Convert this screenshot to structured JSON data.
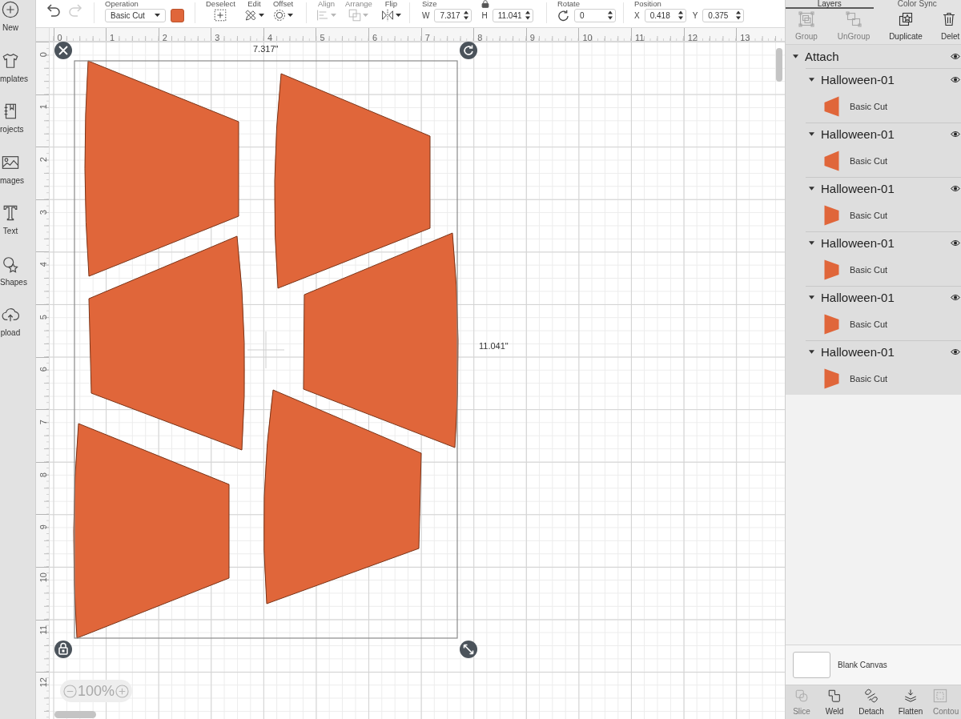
{
  "sidebar": {
    "items": [
      {
        "kind": "new",
        "label": "New"
      },
      {
        "kind": "templates",
        "label": "mplates"
      },
      {
        "kind": "projects",
        "label": "rojects"
      },
      {
        "kind": "images",
        "label": "mages"
      },
      {
        "kind": "text",
        "label": "Text"
      },
      {
        "kind": "shapes",
        "label": "Shapes"
      },
      {
        "kind": "upload",
        "label": "pload"
      }
    ]
  },
  "toolbar": {
    "undo": {
      "disabled": false
    },
    "redo": {
      "disabled": true
    },
    "operation": {
      "label": "Operation",
      "value": "Basic Cut",
      "color": "#e0663a"
    },
    "tool_groups": [
      [
        {
          "kind": "deselect",
          "label": "Deselect",
          "disabled": false,
          "menu": false
        },
        {
          "kind": "edit",
          "label": "Edit",
          "disabled": false,
          "menu": true
        },
        {
          "kind": "offset",
          "label": "Offset",
          "disabled": false,
          "menu": true
        }
      ],
      [
        {
          "kind": "align",
          "label": "Align",
          "disabled": true,
          "menu": true
        },
        {
          "kind": "arrange",
          "label": "Arrange",
          "disabled": true,
          "menu": true
        },
        {
          "kind": "flip",
          "label": "Flip",
          "disabled": false,
          "menu": true
        }
      ]
    ],
    "size": {
      "label": "Size",
      "width": {
        "label": "W",
        "value": "7.317"
      },
      "height": {
        "label": "H",
        "value": "11.041"
      },
      "locked": true
    },
    "rotate": {
      "label": "Rotate",
      "value": "0"
    },
    "position": {
      "label": "Position",
      "x": {
        "label": "X",
        "value": "0.418"
      },
      "y": {
        "label": "Y",
        "value": "0.375"
      }
    }
  },
  "rulers": {
    "horizontal": [
      "0",
      "1",
      "2",
      "3",
      "4",
      "5",
      "6",
      "7",
      "8",
      "9",
      "10",
      "11",
      "12",
      "13"
    ],
    "vertical": [
      "0",
      "1",
      "2",
      "3",
      "4",
      "5",
      "6",
      "7",
      "8",
      "9",
      "10",
      "11",
      "12"
    ]
  },
  "canvas": {
    "width_label": "7.317\"",
    "height_label": "11.041\"",
    "zoom": "100%"
  },
  "layers_panel": {
    "tabs": [
      {
        "label": "Layers",
        "selected": true
      },
      {
        "label": "Color Sync",
        "selected": false
      }
    ],
    "actions": [
      {
        "kind": "group",
        "label": "Group",
        "disabled": true
      },
      {
        "kind": "ungroup",
        "label": "UnGroup",
        "disabled": true
      },
      {
        "kind": "duplicate",
        "label": "Duplicate",
        "disabled": false
      },
      {
        "kind": "delete",
        "label": "Delet",
        "disabled": false
      }
    ],
    "tree": {
      "label": "Attach",
      "expanded": true,
      "visible": true,
      "children": [
        {
          "label": "Halloween-01",
          "expanded": true,
          "visible": true,
          "children": [
            {
              "label": "Basic Cut",
              "kind": "left"
            }
          ]
        },
        {
          "label": "Halloween-01",
          "expanded": true,
          "visible": true,
          "children": [
            {
              "label": "Basic Cut",
              "kind": "left"
            }
          ]
        },
        {
          "label": "Halloween-01",
          "expanded": true,
          "visible": true,
          "children": [
            {
              "label": "Basic Cut",
              "kind": "right"
            }
          ]
        },
        {
          "label": "Halloween-01",
          "expanded": true,
          "visible": true,
          "children": [
            {
              "label": "Basic Cut",
              "kind": "right"
            }
          ]
        },
        {
          "label": "Halloween-01",
          "expanded": true,
          "visible": true,
          "children": [
            {
              "label": "Basic Cut",
              "kind": "right"
            }
          ]
        },
        {
          "label": "Halloween-01",
          "expanded": true,
          "visible": true,
          "children": [
            {
              "label": "Basic Cut",
              "kind": "right"
            }
          ]
        }
      ]
    },
    "canvas_item": {
      "label": "Blank Canvas"
    },
    "bottom_actions": [
      {
        "kind": "slice",
        "label": "Slice",
        "disabled": true
      },
      {
        "kind": "weld",
        "label": "Weld",
        "disabled": false
      },
      {
        "kind": "detach",
        "label": "Detach",
        "disabled": false
      },
      {
        "kind": "flatten",
        "label": "Flatten",
        "disabled": false
      },
      {
        "kind": "contour",
        "label": "Contou",
        "disabled": true
      }
    ]
  }
}
